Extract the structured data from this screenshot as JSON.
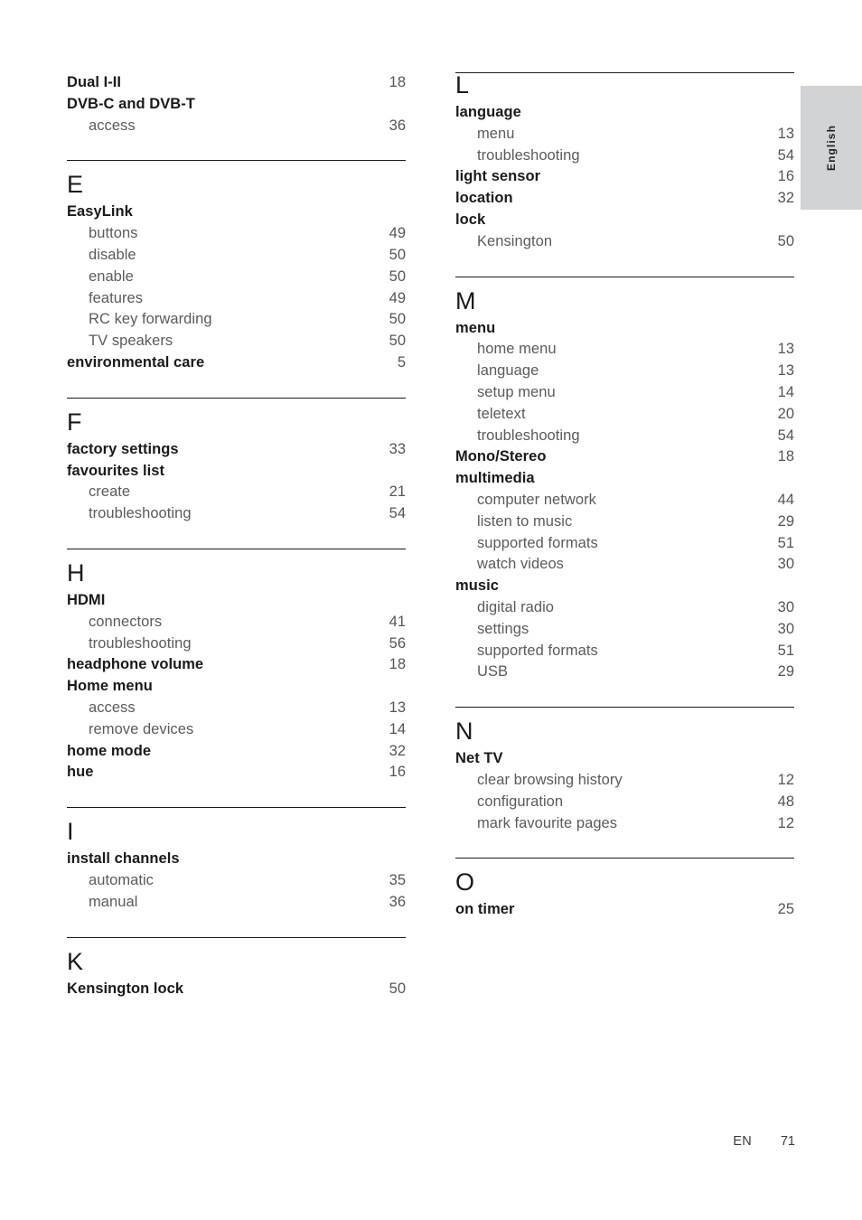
{
  "language_tab": {
    "label": "English"
  },
  "footer": {
    "language_code": "EN",
    "page_number": "71"
  },
  "columns": [
    {
      "name": "left-column",
      "sections": [
        {
          "letter": "",
          "has_rule": false,
          "is_first": true,
          "entries": [
            {
              "label": "Dual I-II",
              "page": "18",
              "level": "main"
            },
            {
              "label": "DVB-C and DVB-T",
              "page": "",
              "level": "main"
            },
            {
              "label": "access",
              "page": "36",
              "level": "sub"
            }
          ]
        },
        {
          "letter": "E",
          "has_rule": true,
          "entries": [
            {
              "label": "EasyLink",
              "page": "",
              "level": "main"
            },
            {
              "label": "buttons",
              "page": "49",
              "level": "sub"
            },
            {
              "label": "disable",
              "page": "50",
              "level": "sub"
            },
            {
              "label": "enable",
              "page": "50",
              "level": "sub"
            },
            {
              "label": "features",
              "page": "49",
              "level": "sub"
            },
            {
              "label": "RC key forwarding",
              "page": "50",
              "level": "sub"
            },
            {
              "label": "TV speakers",
              "page": "50",
              "level": "sub"
            },
            {
              "label": "environmental care",
              "page": "5",
              "level": "main"
            }
          ]
        },
        {
          "letter": "F",
          "has_rule": true,
          "entries": [
            {
              "label": "factory settings",
              "page": "33",
              "level": "main"
            },
            {
              "label": "favourites list",
              "page": "",
              "level": "main"
            },
            {
              "label": "create",
              "page": "21",
              "level": "sub"
            },
            {
              "label": "troubleshooting",
              "page": "54",
              "level": "sub"
            }
          ]
        },
        {
          "letter": "H",
          "has_rule": true,
          "entries": [
            {
              "label": "HDMI",
              "page": "",
              "level": "main"
            },
            {
              "label": "connectors",
              "page": "41",
              "level": "sub"
            },
            {
              "label": "troubleshooting",
              "page": "56",
              "level": "sub"
            },
            {
              "label": "headphone volume",
              "page": "18",
              "level": "main"
            },
            {
              "label": "Home menu",
              "page": "",
              "level": "main"
            },
            {
              "label": "access",
              "page": "13",
              "level": "sub"
            },
            {
              "label": "remove devices",
              "page": "14",
              "level": "sub"
            },
            {
              "label": "home mode",
              "page": "32",
              "level": "main"
            },
            {
              "label": "hue",
              "page": "16",
              "level": "main"
            }
          ]
        },
        {
          "letter": "I",
          "has_rule": true,
          "entries": [
            {
              "label": "install channels",
              "page": "",
              "level": "main"
            },
            {
              "label": "automatic",
              "page": "35",
              "level": "sub"
            },
            {
              "label": "manual",
              "page": "36",
              "level": "sub"
            }
          ]
        },
        {
          "letter": "K",
          "has_rule": true,
          "entries": [
            {
              "label": "Kensington lock",
              "page": "50",
              "level": "main"
            }
          ]
        }
      ]
    },
    {
      "name": "right-column",
      "sections": [
        {
          "letter": "L",
          "has_rule": true,
          "is_first": true,
          "entries": [
            {
              "label": "language",
              "page": "",
              "level": "main"
            },
            {
              "label": "menu",
              "page": "13",
              "level": "sub"
            },
            {
              "label": "troubleshooting",
              "page": "54",
              "level": "sub"
            },
            {
              "label": "light sensor",
              "page": "16",
              "level": "main"
            },
            {
              "label": "location",
              "page": "32",
              "level": "main"
            },
            {
              "label": "lock",
              "page": "",
              "level": "main"
            },
            {
              "label": "Kensington",
              "page": "50",
              "level": "sub"
            }
          ]
        },
        {
          "letter": "M",
          "has_rule": true,
          "entries": [
            {
              "label": "menu",
              "page": "",
              "level": "main"
            },
            {
              "label": "home menu",
              "page": "13",
              "level": "sub"
            },
            {
              "label": "language",
              "page": "13",
              "level": "sub"
            },
            {
              "label": "setup menu",
              "page": "14",
              "level": "sub"
            },
            {
              "label": "teletext",
              "page": "20",
              "level": "sub"
            },
            {
              "label": "troubleshooting",
              "page": "54",
              "level": "sub"
            },
            {
              "label": "Mono/Stereo",
              "page": "18",
              "level": "main"
            },
            {
              "label": "multimedia",
              "page": "",
              "level": "main"
            },
            {
              "label": "computer network",
              "page": "44",
              "level": "sub"
            },
            {
              "label": "listen to music",
              "page": "29",
              "level": "sub"
            },
            {
              "label": "supported formats",
              "page": "51",
              "level": "sub"
            },
            {
              "label": "watch videos",
              "page": "30",
              "level": "sub"
            },
            {
              "label": "music",
              "page": "",
              "level": "main"
            },
            {
              "label": "digital radio",
              "page": "30",
              "level": "sub"
            },
            {
              "label": "settings",
              "page": "30",
              "level": "sub"
            },
            {
              "label": "supported formats",
              "page": "51",
              "level": "sub"
            },
            {
              "label": "USB",
              "page": "29",
              "level": "sub"
            }
          ]
        },
        {
          "letter": "N",
          "has_rule": true,
          "entries": [
            {
              "label": "Net TV",
              "page": "",
              "level": "main"
            },
            {
              "label": "clear browsing history",
              "page": "12",
              "level": "sub"
            },
            {
              "label": "configuration",
              "page": "48",
              "level": "sub"
            },
            {
              "label": "mark favourite pages",
              "page": "12",
              "level": "sub"
            }
          ]
        },
        {
          "letter": "O",
          "has_rule": true,
          "entries": [
            {
              "label": "on timer",
              "page": "25",
              "level": "main"
            }
          ]
        }
      ]
    }
  ]
}
